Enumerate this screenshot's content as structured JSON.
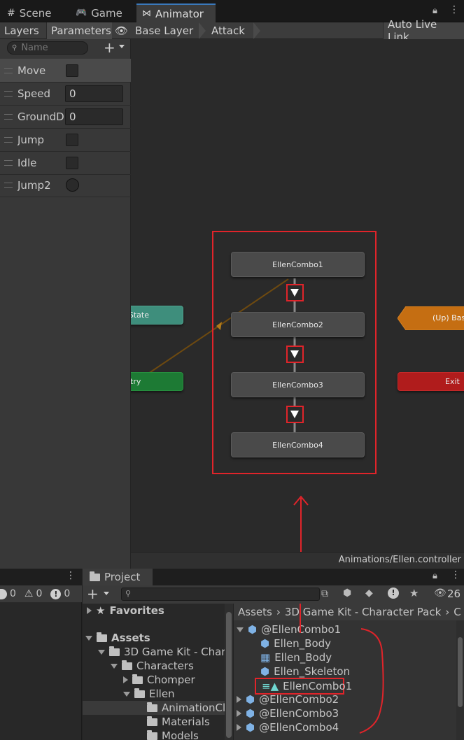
{
  "tabs": {
    "scene": "Scene",
    "game": "Game",
    "animator": "Animator"
  },
  "toolbar": {
    "layers": "Layers",
    "parameters": "Parameters",
    "base_layer": "Base Layer",
    "attack": "Attack",
    "auto_live_link": "Auto Live Link"
  },
  "params": {
    "search_placeholder": "Name",
    "items": [
      {
        "label": "Move",
        "type": "bool"
      },
      {
        "label": "Speed",
        "type": "float",
        "value": "0"
      },
      {
        "label": "GroundDi",
        "type": "float",
        "value": "0"
      },
      {
        "label": "Jump",
        "type": "bool"
      },
      {
        "label": "Idle",
        "type": "bool"
      },
      {
        "label": "Jump2",
        "type": "trigger"
      }
    ]
  },
  "graph": {
    "states": [
      "EllenCombo1",
      "EllenCombo2",
      "EllenCombo3",
      "EllenCombo4"
    ],
    "any_state": "State",
    "entry": "try",
    "up_base": "(Up) Bas",
    "exit": "Exit",
    "footer_path": "Animations/Ellen.controller",
    "colors": {
      "highlight": "#e0242a",
      "entry": "#1d7a34",
      "any_state": "#3e8e7c",
      "exit": "#b01c1c",
      "up": "#c56e12"
    }
  },
  "console": {
    "count_a": "0",
    "count_b": "0",
    "count_c": "0"
  },
  "project": {
    "tab": "Project",
    "badge_count": "26",
    "breadcrumb": [
      "Assets",
      "3D Game Kit - Character Pack",
      "C"
    ],
    "tree": {
      "favorites": "Favorites",
      "assets": "Assets",
      "kit": "3D Game Kit - Char",
      "characters": "Characters",
      "chomper": "Chomper",
      "ellen": "Ellen",
      "animation_clips": "AnimationCl",
      "materials": "Materials",
      "models": "Models"
    },
    "files": [
      {
        "name": "@EllenCombo1",
        "icon": "model-icon"
      },
      {
        "name": "Ellen_Body",
        "icon": "mesh-icon"
      },
      {
        "name": "Ellen_Body",
        "icon": "grid-icon"
      },
      {
        "name": "Ellen_Skeleton",
        "icon": "mesh-icon"
      },
      {
        "name": "EllenCombo1",
        "icon": "animation-clip-icon"
      },
      {
        "name": "@EllenCombo2",
        "icon": "model-icon"
      },
      {
        "name": "@EllenCombo3",
        "icon": "model-icon"
      },
      {
        "name": "@EllenCombo4",
        "icon": "model-icon"
      }
    ]
  }
}
